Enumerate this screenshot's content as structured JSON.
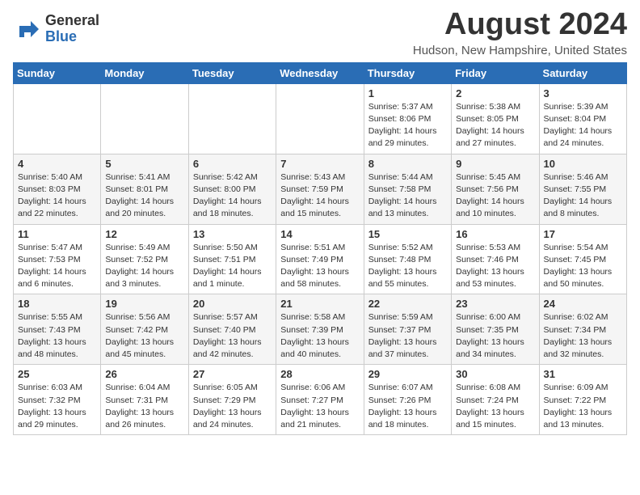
{
  "logo": {
    "general": "General",
    "blue": "Blue"
  },
  "title": {
    "month_year": "August 2024",
    "location": "Hudson, New Hampshire, United States"
  },
  "weekdays": [
    "Sunday",
    "Monday",
    "Tuesday",
    "Wednesday",
    "Thursday",
    "Friday",
    "Saturday"
  ],
  "weeks": [
    [
      {
        "day": "",
        "info": ""
      },
      {
        "day": "",
        "info": ""
      },
      {
        "day": "",
        "info": ""
      },
      {
        "day": "",
        "info": ""
      },
      {
        "day": "1",
        "info": "Sunrise: 5:37 AM\nSunset: 8:06 PM\nDaylight: 14 hours\nand 29 minutes."
      },
      {
        "day": "2",
        "info": "Sunrise: 5:38 AM\nSunset: 8:05 PM\nDaylight: 14 hours\nand 27 minutes."
      },
      {
        "day": "3",
        "info": "Sunrise: 5:39 AM\nSunset: 8:04 PM\nDaylight: 14 hours\nand 24 minutes."
      }
    ],
    [
      {
        "day": "4",
        "info": "Sunrise: 5:40 AM\nSunset: 8:03 PM\nDaylight: 14 hours\nand 22 minutes."
      },
      {
        "day": "5",
        "info": "Sunrise: 5:41 AM\nSunset: 8:01 PM\nDaylight: 14 hours\nand 20 minutes."
      },
      {
        "day": "6",
        "info": "Sunrise: 5:42 AM\nSunset: 8:00 PM\nDaylight: 14 hours\nand 18 minutes."
      },
      {
        "day": "7",
        "info": "Sunrise: 5:43 AM\nSunset: 7:59 PM\nDaylight: 14 hours\nand 15 minutes."
      },
      {
        "day": "8",
        "info": "Sunrise: 5:44 AM\nSunset: 7:58 PM\nDaylight: 14 hours\nand 13 minutes."
      },
      {
        "day": "9",
        "info": "Sunrise: 5:45 AM\nSunset: 7:56 PM\nDaylight: 14 hours\nand 10 minutes."
      },
      {
        "day": "10",
        "info": "Sunrise: 5:46 AM\nSunset: 7:55 PM\nDaylight: 14 hours\nand 8 minutes."
      }
    ],
    [
      {
        "day": "11",
        "info": "Sunrise: 5:47 AM\nSunset: 7:53 PM\nDaylight: 14 hours\nand 6 minutes."
      },
      {
        "day": "12",
        "info": "Sunrise: 5:49 AM\nSunset: 7:52 PM\nDaylight: 14 hours\nand 3 minutes."
      },
      {
        "day": "13",
        "info": "Sunrise: 5:50 AM\nSunset: 7:51 PM\nDaylight: 14 hours\nand 1 minute."
      },
      {
        "day": "14",
        "info": "Sunrise: 5:51 AM\nSunset: 7:49 PM\nDaylight: 13 hours\nand 58 minutes."
      },
      {
        "day": "15",
        "info": "Sunrise: 5:52 AM\nSunset: 7:48 PM\nDaylight: 13 hours\nand 55 minutes."
      },
      {
        "day": "16",
        "info": "Sunrise: 5:53 AM\nSunset: 7:46 PM\nDaylight: 13 hours\nand 53 minutes."
      },
      {
        "day": "17",
        "info": "Sunrise: 5:54 AM\nSunset: 7:45 PM\nDaylight: 13 hours\nand 50 minutes."
      }
    ],
    [
      {
        "day": "18",
        "info": "Sunrise: 5:55 AM\nSunset: 7:43 PM\nDaylight: 13 hours\nand 48 minutes."
      },
      {
        "day": "19",
        "info": "Sunrise: 5:56 AM\nSunset: 7:42 PM\nDaylight: 13 hours\nand 45 minutes."
      },
      {
        "day": "20",
        "info": "Sunrise: 5:57 AM\nSunset: 7:40 PM\nDaylight: 13 hours\nand 42 minutes."
      },
      {
        "day": "21",
        "info": "Sunrise: 5:58 AM\nSunset: 7:39 PM\nDaylight: 13 hours\nand 40 minutes."
      },
      {
        "day": "22",
        "info": "Sunrise: 5:59 AM\nSunset: 7:37 PM\nDaylight: 13 hours\nand 37 minutes."
      },
      {
        "day": "23",
        "info": "Sunrise: 6:00 AM\nSunset: 7:35 PM\nDaylight: 13 hours\nand 34 minutes."
      },
      {
        "day": "24",
        "info": "Sunrise: 6:02 AM\nSunset: 7:34 PM\nDaylight: 13 hours\nand 32 minutes."
      }
    ],
    [
      {
        "day": "25",
        "info": "Sunrise: 6:03 AM\nSunset: 7:32 PM\nDaylight: 13 hours\nand 29 minutes."
      },
      {
        "day": "26",
        "info": "Sunrise: 6:04 AM\nSunset: 7:31 PM\nDaylight: 13 hours\nand 26 minutes."
      },
      {
        "day": "27",
        "info": "Sunrise: 6:05 AM\nSunset: 7:29 PM\nDaylight: 13 hours\nand 24 minutes."
      },
      {
        "day": "28",
        "info": "Sunrise: 6:06 AM\nSunset: 7:27 PM\nDaylight: 13 hours\nand 21 minutes."
      },
      {
        "day": "29",
        "info": "Sunrise: 6:07 AM\nSunset: 7:26 PM\nDaylight: 13 hours\nand 18 minutes."
      },
      {
        "day": "30",
        "info": "Sunrise: 6:08 AM\nSunset: 7:24 PM\nDaylight: 13 hours\nand 15 minutes."
      },
      {
        "day": "31",
        "info": "Sunrise: 6:09 AM\nSunset: 7:22 PM\nDaylight: 13 hours\nand 13 minutes."
      }
    ]
  ]
}
